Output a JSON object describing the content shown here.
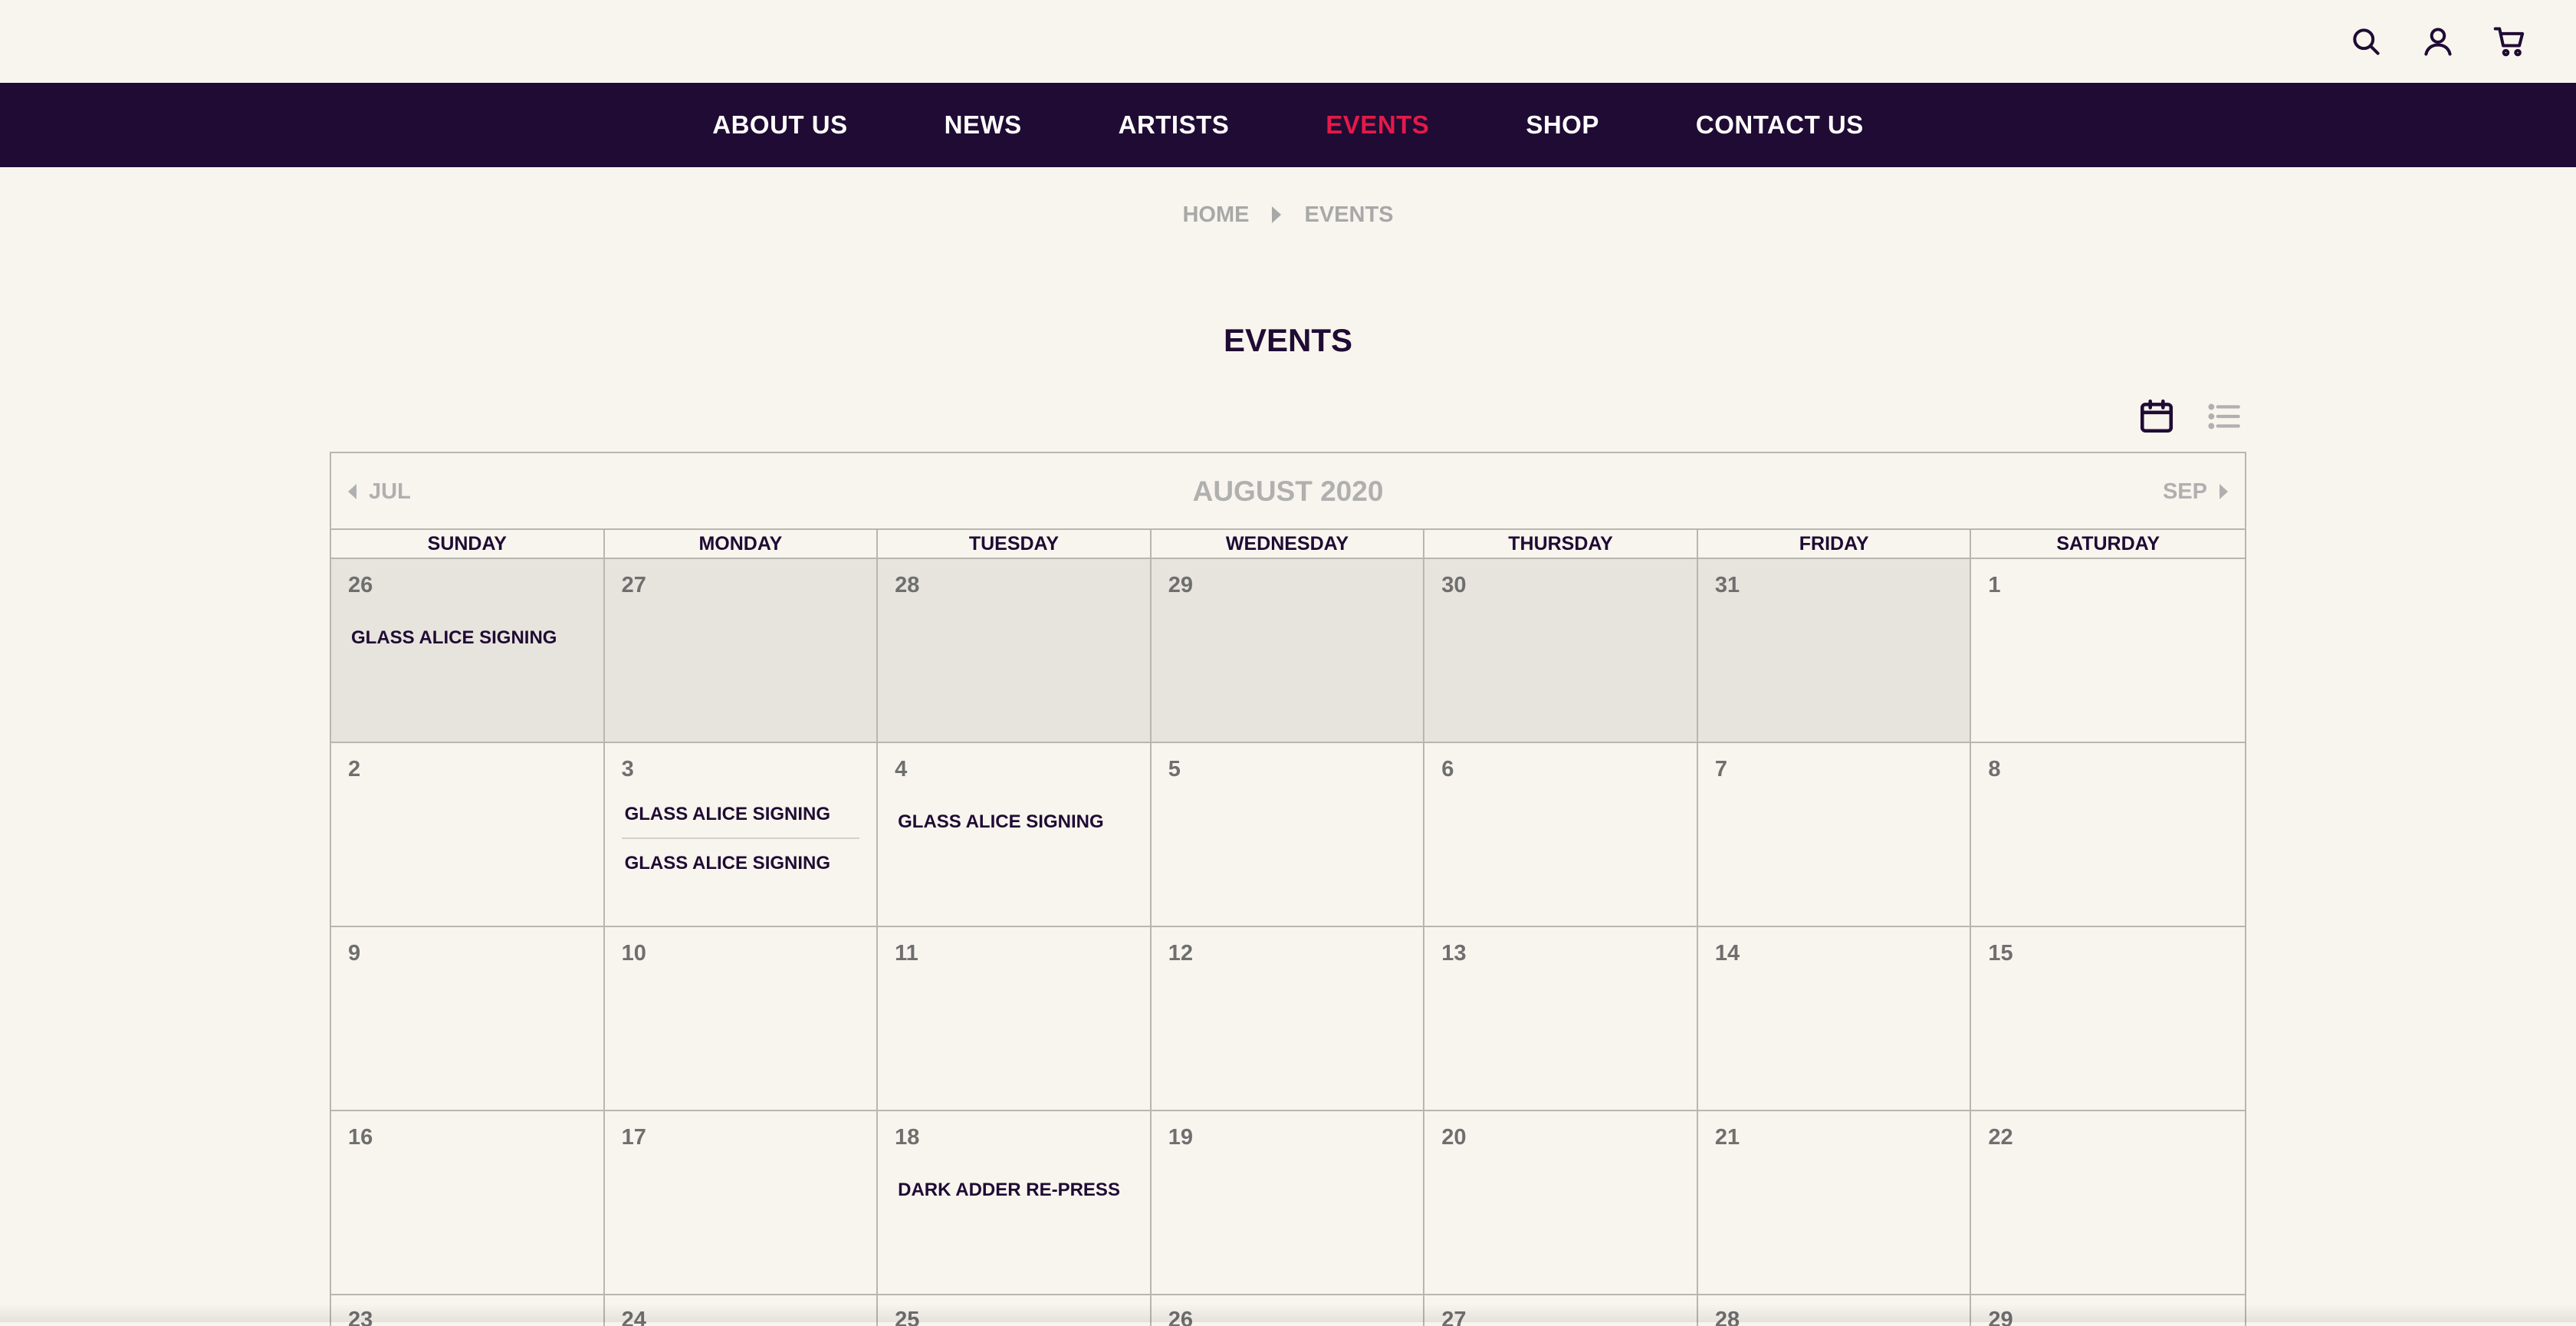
{
  "header": {
    "icons": [
      "search-icon",
      "account-icon",
      "cart-icon"
    ]
  },
  "nav": {
    "items": [
      {
        "label": "ABOUT US",
        "active": false
      },
      {
        "label": "NEWS",
        "active": false
      },
      {
        "label": "ARTISTS",
        "active": false
      },
      {
        "label": "EVENTS",
        "active": true
      },
      {
        "label": "SHOP",
        "active": false
      },
      {
        "label": "CONTACT US",
        "active": false
      }
    ],
    "active_color": "#e31a4a",
    "background": "#1f0b34"
  },
  "breadcrumb": {
    "home": "HOME",
    "current": "EVENTS"
  },
  "page": {
    "title": "EVENTS"
  },
  "view_toggle": {
    "calendar_icon": "calendar-icon",
    "list_icon": "list-icon",
    "active": "calendar"
  },
  "calendar": {
    "prev_label": "JUL",
    "next_label": "SEP",
    "month_label": "AUGUST 2020",
    "weekdays": [
      "SUNDAY",
      "MONDAY",
      "TUESDAY",
      "WEDNESDAY",
      "THURSDAY",
      "FRIDAY",
      "SATURDAY"
    ],
    "weeks": [
      [
        {
          "day": "26",
          "other": true,
          "events": [
            "GLASS ALICE SIGNING"
          ]
        },
        {
          "day": "27",
          "other": true,
          "events": []
        },
        {
          "day": "28",
          "other": true,
          "events": []
        },
        {
          "day": "29",
          "other": true,
          "events": []
        },
        {
          "day": "30",
          "other": true,
          "events": []
        },
        {
          "day": "31",
          "other": true,
          "events": []
        },
        {
          "day": "1",
          "other": false,
          "events": []
        }
      ],
      [
        {
          "day": "2",
          "other": false,
          "events": []
        },
        {
          "day": "3",
          "other": false,
          "events": [
            "GLASS ALICE SIGNING",
            "GLASS ALICE SIGNING"
          ]
        },
        {
          "day": "4",
          "other": false,
          "events": [
            "GLASS ALICE SIGNING"
          ]
        },
        {
          "day": "5",
          "other": false,
          "events": []
        },
        {
          "day": "6",
          "other": false,
          "events": []
        },
        {
          "day": "7",
          "other": false,
          "events": []
        },
        {
          "day": "8",
          "other": false,
          "events": []
        }
      ],
      [
        {
          "day": "9",
          "other": false,
          "events": []
        },
        {
          "day": "10",
          "other": false,
          "events": []
        },
        {
          "day": "11",
          "other": false,
          "events": []
        },
        {
          "day": "12",
          "other": false,
          "events": []
        },
        {
          "day": "13",
          "other": false,
          "events": []
        },
        {
          "day": "14",
          "other": false,
          "events": []
        },
        {
          "day": "15",
          "other": false,
          "events": []
        }
      ],
      [
        {
          "day": "16",
          "other": false,
          "events": []
        },
        {
          "day": "17",
          "other": false,
          "events": []
        },
        {
          "day": "18",
          "other": false,
          "events": [
            "DARK ADDER RE-PRESS"
          ]
        },
        {
          "day": "19",
          "other": false,
          "events": []
        },
        {
          "day": "20",
          "other": false,
          "events": []
        },
        {
          "day": "21",
          "other": false,
          "events": []
        },
        {
          "day": "22",
          "other": false,
          "events": []
        }
      ],
      [
        {
          "day": "23",
          "other": false,
          "events": []
        },
        {
          "day": "24",
          "other": false,
          "events": []
        },
        {
          "day": "25",
          "other": false,
          "events": []
        },
        {
          "day": "26",
          "other": false,
          "events": []
        },
        {
          "day": "27",
          "other": false,
          "events": []
        },
        {
          "day": "28",
          "other": false,
          "events": []
        },
        {
          "day": "29",
          "other": false,
          "events": []
        }
      ]
    ]
  }
}
